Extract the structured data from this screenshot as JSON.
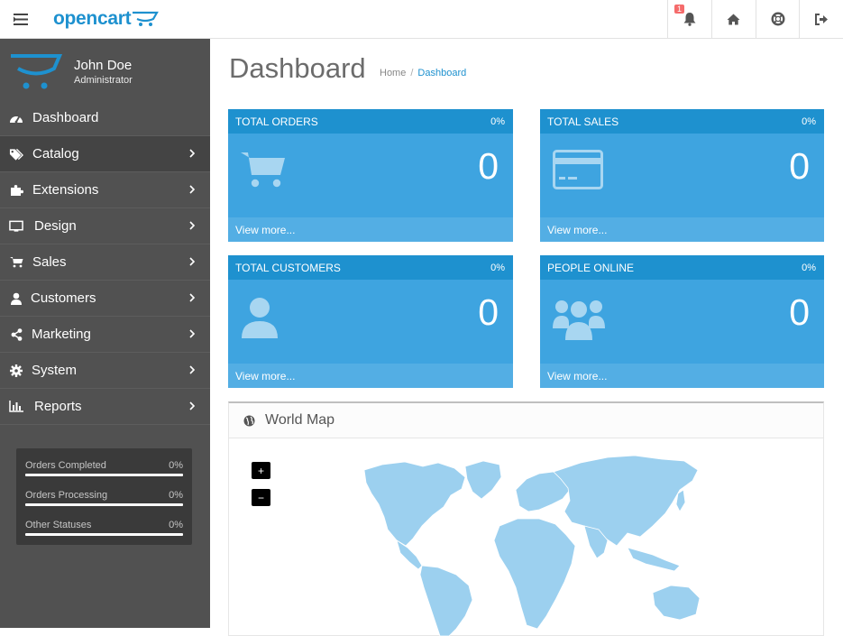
{
  "header": {
    "logo_text": "opencart",
    "notification_count": "1",
    "icons": [
      "menu-icon",
      "bell-icon",
      "home-icon",
      "life-ring-icon",
      "sign-out-icon"
    ],
    "accent_color": "#1e91cf"
  },
  "profile": {
    "name": "John Doe",
    "role": "Administrator"
  },
  "nav": {
    "items": [
      {
        "label": "Dashboard",
        "icon": "dashboard-icon"
      },
      {
        "label": "Catalog",
        "icon": "tags-icon"
      },
      {
        "label": "Extensions",
        "icon": "puzzle-icon"
      },
      {
        "label": "Design",
        "icon": "monitor-icon"
      },
      {
        "label": "Sales",
        "icon": "cart-icon"
      },
      {
        "label": "Customers",
        "icon": "user-icon"
      },
      {
        "label": "Marketing",
        "icon": "share-icon"
      },
      {
        "label": "System",
        "icon": "gear-icon"
      },
      {
        "label": "Reports",
        "icon": "bar-chart-icon"
      }
    ]
  },
  "stats": [
    {
      "label": "Orders Completed",
      "value": "0%"
    },
    {
      "label": "Orders Processing",
      "value": "0%"
    },
    {
      "label": "Other Statuses",
      "value": "0%"
    }
  ],
  "page": {
    "title": "Dashboard",
    "breadcrumb": [
      "Home",
      "/",
      "Dashboard"
    ]
  },
  "tiles": [
    {
      "title": "TOTAL ORDERS",
      "percent": "0%",
      "value": "0",
      "link": "View more...",
      "icon": "shopping-cart-icon"
    },
    {
      "title": "TOTAL SALES",
      "percent": "0%",
      "value": "0",
      "link": "View more...",
      "icon": "credit-card-icon"
    },
    {
      "title": "TOTAL CUSTOMERS",
      "percent": "0%",
      "value": "0",
      "link": "View more...",
      "icon": "user-icon"
    },
    {
      "title": "PEOPLE ONLINE",
      "percent": "0%",
      "value": "0",
      "link": "View more...",
      "icon": "users-icon"
    }
  ],
  "map": {
    "title": "World Map",
    "zoom_in": "+",
    "zoom_out": "−",
    "land_color": "#9cd0ef"
  }
}
